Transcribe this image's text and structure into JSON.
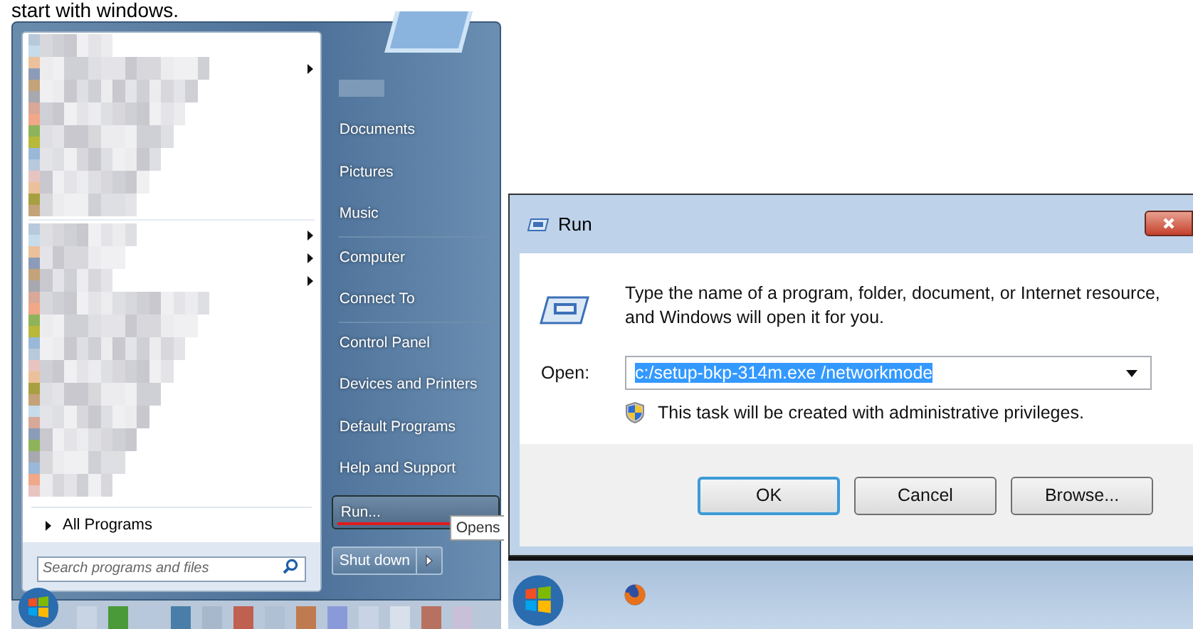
{
  "caption": "start with windows.",
  "start_menu": {
    "program_groups": [
      [
        {
          "submenu": false
        },
        {
          "submenu": true
        },
        {
          "submenu": false
        },
        {
          "submenu": false
        },
        {
          "submenu": false
        },
        {
          "submenu": false
        },
        {
          "submenu": false
        },
        {
          "submenu": false
        }
      ],
      [
        {
          "submenu": true
        },
        {
          "submenu": true
        },
        {
          "submenu": true
        },
        {
          "submenu": false
        },
        {
          "submenu": false
        },
        {
          "submenu": false
        },
        {
          "submenu": false
        },
        {
          "submenu": false
        },
        {
          "submenu": false
        },
        {
          "submenu": false
        },
        {
          "submenu": false
        },
        {
          "submenu": false
        }
      ]
    ],
    "all_programs": "All Programs",
    "search": {
      "placeholder": "Search programs and files"
    },
    "places": [
      {
        "label": "Documents",
        "separator_after": false,
        "selected": false
      },
      {
        "label": "Pictures",
        "separator_after": false,
        "selected": false
      },
      {
        "label": "Music",
        "separator_after": true,
        "selected": false
      },
      {
        "label": "Computer",
        "separator_after": false,
        "selected": false
      },
      {
        "label": "Connect To",
        "separator_after": true,
        "selected": false
      },
      {
        "label": "Control Panel",
        "separator_after": false,
        "selected": false
      },
      {
        "label": "Devices and Printers",
        "separator_after": false,
        "selected": false
      },
      {
        "label": "Default Programs",
        "separator_after": false,
        "selected": false
      },
      {
        "label": "Help and Support",
        "separator_after": false,
        "selected": false
      },
      {
        "label": "Run...",
        "separator_after": false,
        "selected": true
      }
    ],
    "shut_down": "Shut down",
    "tooltip": "Opens"
  },
  "run_dialog": {
    "title": "Run",
    "description": "Type the name of a program, folder, document, or Internet resource, and Windows will open it for you.",
    "open_label": "Open:",
    "command": {
      "value": "c:/setup-bkp-314m.exe /networkmode",
      "text_selected": true
    },
    "admin_note": "This task will be created with administrative privileges.",
    "buttons": [
      {
        "label": "OK",
        "focused": true
      },
      {
        "label": "Cancel",
        "focused": false
      },
      {
        "label": "Browse...",
        "focused": false
      }
    ]
  }
}
